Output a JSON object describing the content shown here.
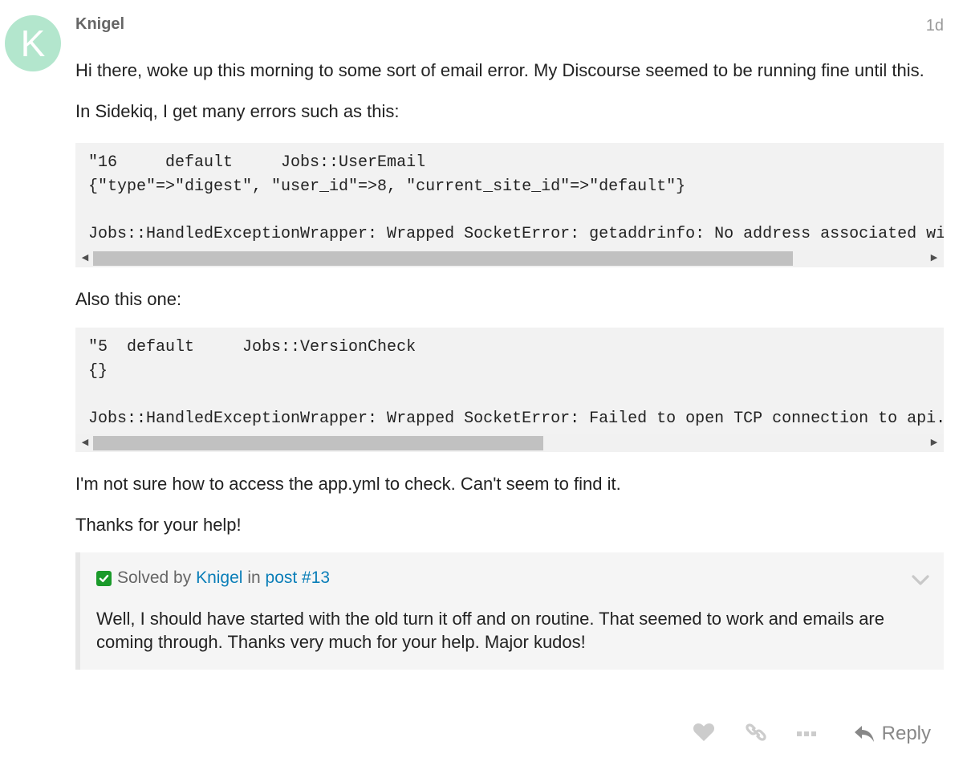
{
  "post": {
    "avatar_letter": "K",
    "avatar_color": "#b3e6cd",
    "username": "Knigel",
    "date": "1d",
    "paragraphs": [
      "Hi there, woke up this morning to some sort of email error. My Discourse seemed to be running fine until this.",
      "In Sidekiq, I get many errors such as this:",
      "Also this one:",
      "I'm not sure how to access the app.yml to check. Can't seem to find it.",
      "Thanks for your help!"
    ],
    "code_blocks": [
      {
        "text": "\"16     default     Jobs::UserEmail\n{\"type\"=>\"digest\", \"user_id\"=>8, \"current_site_id\"=>\"default\"}\n\nJobs::HandledExceptionWrapper: Wrapped SocketError: getaddrinfo: No address associated with hostname",
        "scroll_thumb_fraction": 0.84
      },
      {
        "text": "\"5  default     Jobs::VersionCheck\n{}\n\nJobs::HandledExceptionWrapper: Wrapped SocketError: Failed to open TCP connection to api.discourse.org",
        "scroll_thumb_fraction": 0.54
      }
    ]
  },
  "solution": {
    "prefix": "Solved by",
    "author": "Knigel",
    "in_word": "in",
    "post_link": "post #13",
    "text": "Well, I should have started with the old turn it off and on routine. That seemed to work and emails are coming through. Thanks very much for your help. Major kudos!",
    "check_color": "#1a9a2a"
  },
  "actions": {
    "like_icon": "heart-icon",
    "link_icon": "link-icon",
    "more_icon": "ellipsis-icon",
    "reply_label": "Reply"
  }
}
